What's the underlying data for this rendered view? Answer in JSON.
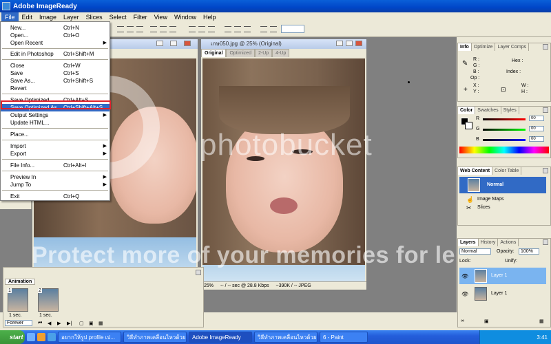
{
  "window": {
    "title": "Adobe ImageReady"
  },
  "menubar": [
    "File",
    "Edit",
    "Image",
    "Layer",
    "Slices",
    "Select",
    "Filter",
    "View",
    "Window",
    "Help"
  ],
  "file_menu": {
    "items": [
      {
        "label": "New...",
        "shortcut": "Ctrl+N"
      },
      {
        "label": "Open...",
        "shortcut": "Ctrl+O"
      },
      {
        "label": "Open Recent",
        "shortcut": "",
        "submenu": true
      },
      {
        "label": "Edit in Photoshop",
        "shortcut": "Ctrl+Shift+M"
      },
      {
        "label": "Close",
        "shortcut": "Ctrl+W"
      },
      {
        "label": "Save",
        "shortcut": "Ctrl+S"
      },
      {
        "label": "Save As...",
        "shortcut": "Ctrl+Shift+S"
      },
      {
        "label": "Revert",
        "shortcut": ""
      },
      {
        "label": "Save Optimized",
        "shortcut": "Ctrl+Alt+S"
      },
      {
        "label": "Save Optimized As...",
        "shortcut": "Ctrl+Shift+Alt+S",
        "highlighted": true
      },
      {
        "label": "Output Settings",
        "shortcut": "",
        "submenu": true
      },
      {
        "label": "Update HTML...",
        "shortcut": ""
      },
      {
        "label": "Place...",
        "shortcut": ""
      },
      {
        "label": "Import",
        "shortcut": "",
        "submenu": true
      },
      {
        "label": "Export",
        "shortcut": "",
        "submenu": true
      },
      {
        "label": "File Info...",
        "shortcut": "Ctrl+Alt+I"
      },
      {
        "label": "Preview In",
        "shortcut": "",
        "submenu": true
      },
      {
        "label": "Jump To",
        "shortcut": "",
        "submenu": true
      },
      {
        "label": "Exit",
        "shortcut": "Ctrl+Q"
      }
    ]
  },
  "doc_right": {
    "title": "เกษ050.jpg @ 25% (Original)",
    "tabs": [
      "Original",
      "Optimized",
      "2-Up",
      "4-Up"
    ],
    "status": [
      "25%",
      "-- / -- sec @ 28.8 Kbps",
      "~390K / -- JPEG"
    ]
  },
  "info_palette": {
    "tabs": [
      "Info",
      "Optimize",
      "Layer Comps"
    ],
    "labels": [
      "R :",
      "G :",
      "B :",
      "Op :",
      "Hex :",
      "Index :",
      "X :",
      "Y :",
      "W :",
      "H :"
    ]
  },
  "color_palette": {
    "tabs": [
      "Color",
      "Swatches",
      "Styles"
    ],
    "channels": [
      {
        "name": "R",
        "value": "00"
      },
      {
        "name": "G",
        "value": "00"
      },
      {
        "name": "B",
        "value": "00"
      }
    ]
  },
  "web_content": {
    "tabs": [
      "Web Content",
      "Color Table"
    ],
    "rows": [
      "Normal",
      "Image Maps",
      "Slices"
    ]
  },
  "layers_palette": {
    "tabs": [
      "Layers",
      "History",
      "Actions"
    ],
    "blend_mode": "Normal",
    "opacity_label": "Opacity:",
    "opacity": "100%",
    "lock_label": "Lock:",
    "unify_label": "Unify:",
    "layers": [
      "Layer 1",
      "Layer 1"
    ]
  },
  "animation": {
    "tab": "Animation",
    "frames": [
      {
        "num": "1",
        "delay": "1 sec."
      },
      {
        "num": "2",
        "delay": "1 sec."
      }
    ],
    "loop": "Forever"
  },
  "watermark": {
    "logo": "photobucket",
    "tagline": "Protect more of your memories for le"
  },
  "taskbar": {
    "start": "start",
    "tasks": [
      "อยากให้รูป profile เป...",
      "วิธีทำภาพเคลื่อนไหวด้วย Im...",
      "Adobe ImageReady",
      "วิธีทำภาพเคลื่อนไหวด้วย Im...",
      "6 - Paint"
    ],
    "clock": "3:41"
  }
}
